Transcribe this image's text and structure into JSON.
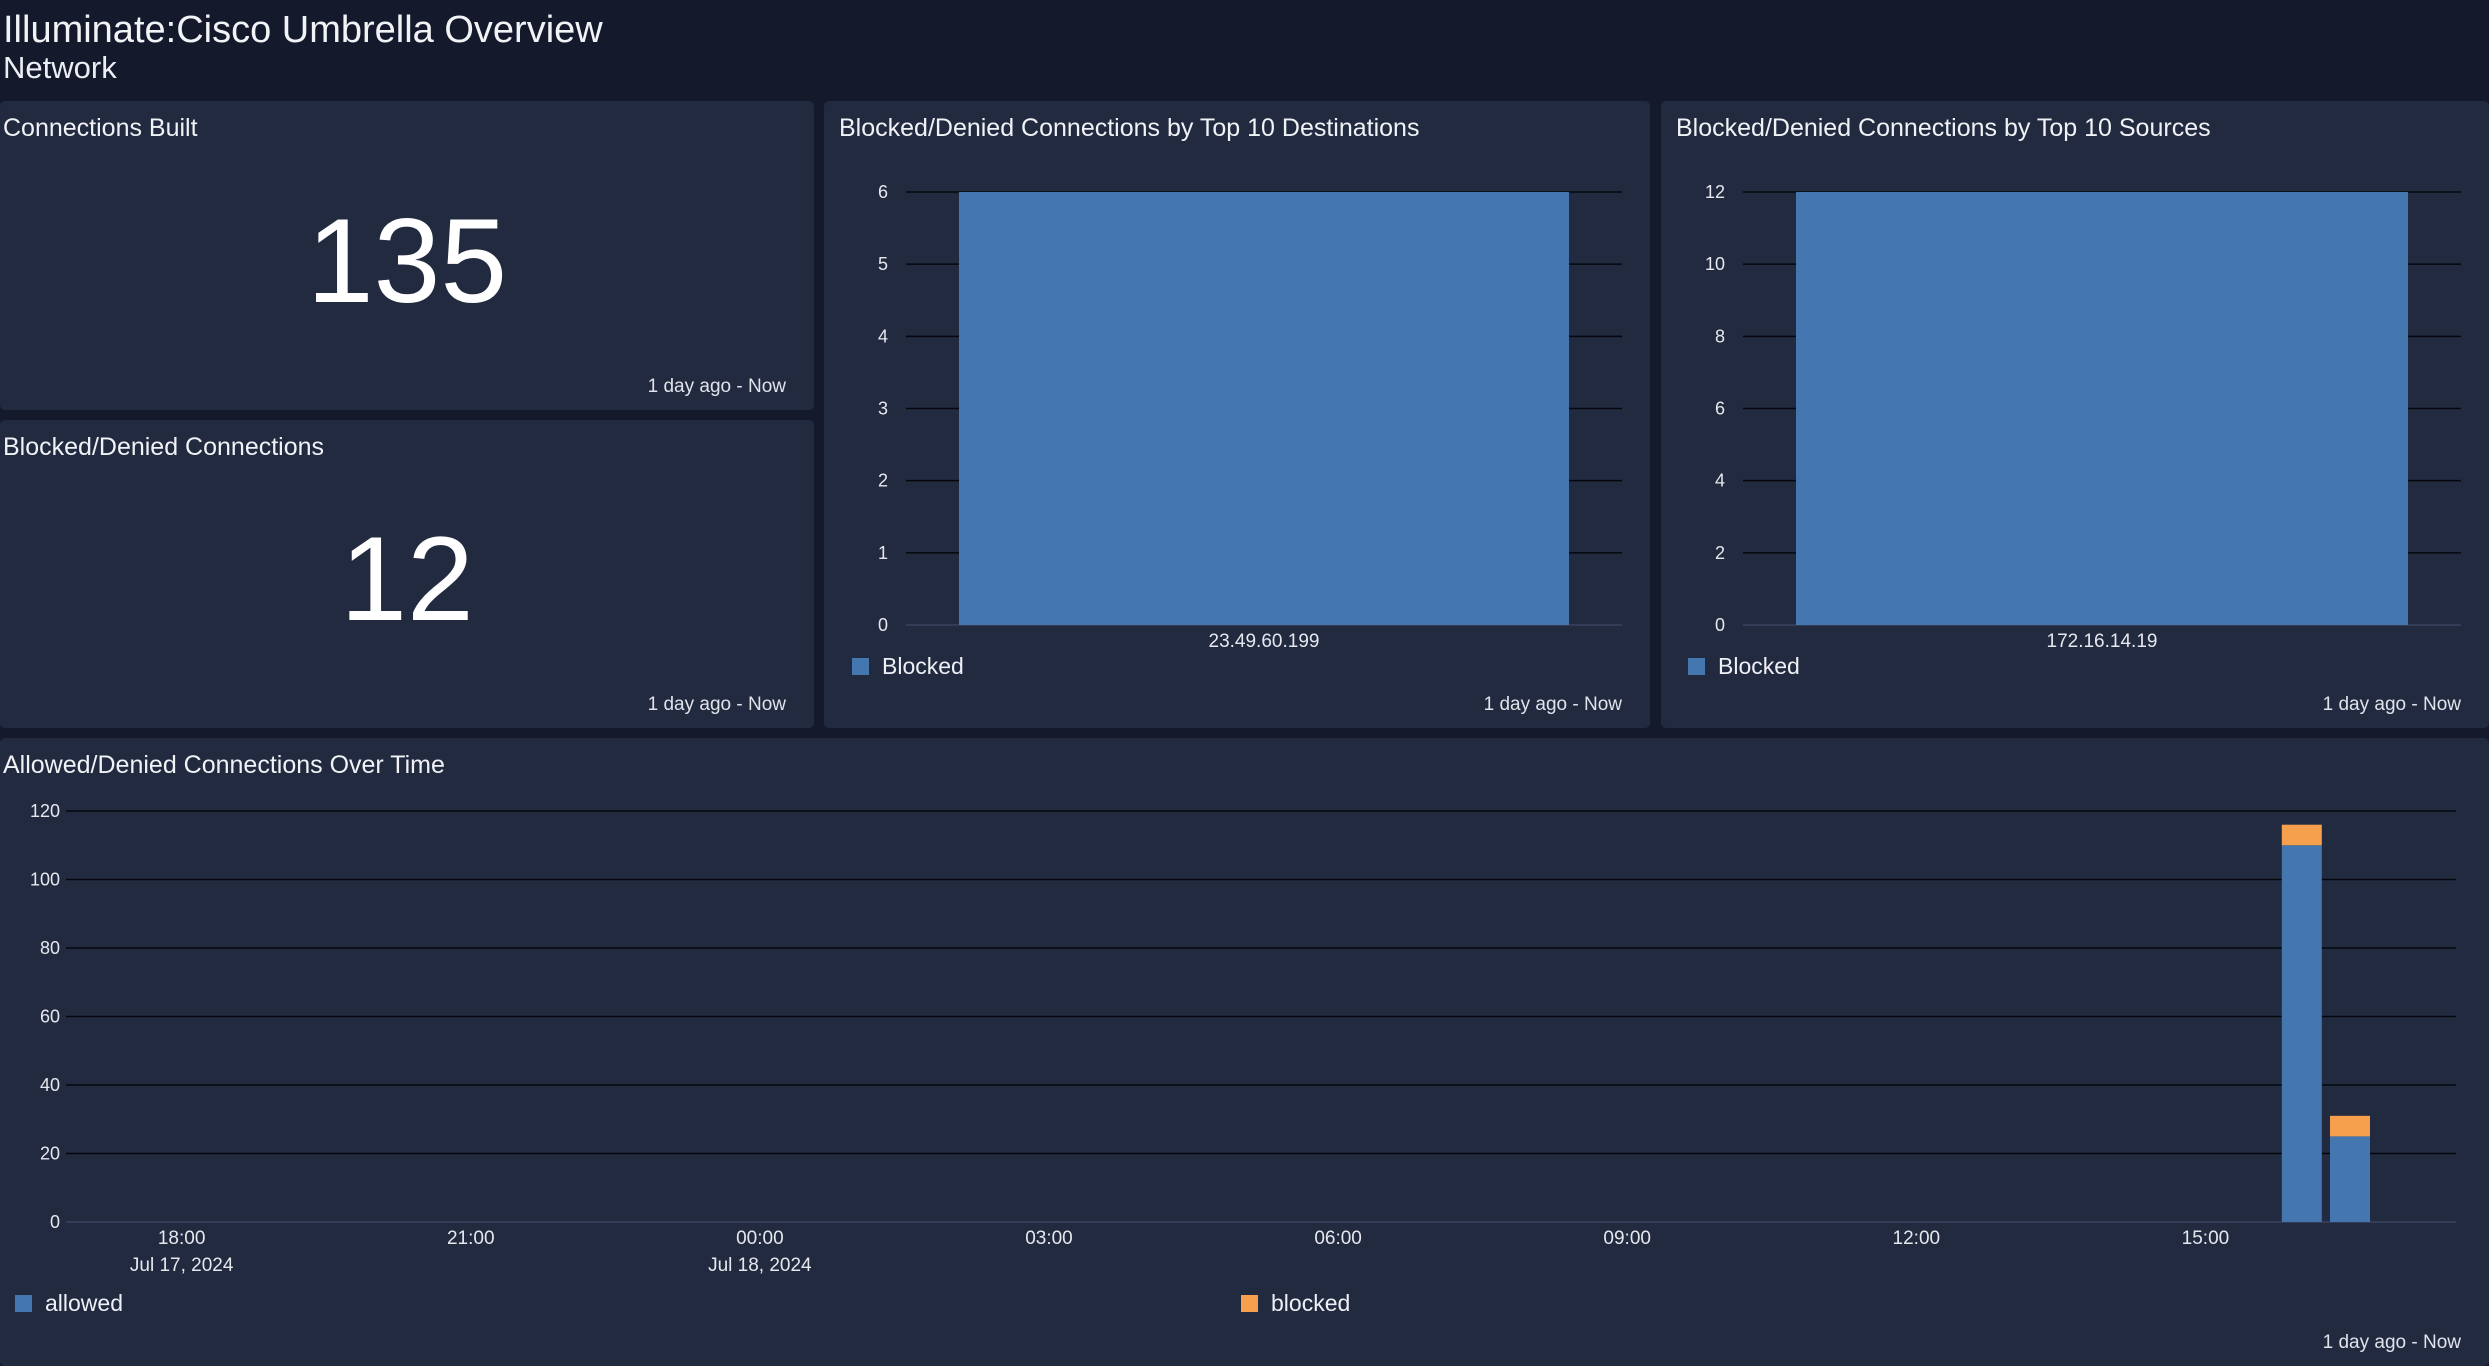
{
  "dashboard": {
    "title": "Illuminate:Cisco Umbrella Overview",
    "subtitle": "Network"
  },
  "colors": {
    "background": "#141a2b",
    "panel": "#222a40",
    "allowed": "#4477b0",
    "blocked": "#f6a04d"
  },
  "panels": {
    "connections_built": {
      "title": "Connections Built",
      "value": "135",
      "range": "1 day ago - Now"
    },
    "blocked_denied": {
      "title": "Blocked/Denied Connections",
      "value": "12",
      "range": "1 day ago - Now"
    },
    "top_destinations": {
      "title": "Blocked/Denied Connections by Top 10 Destinations",
      "legend": "Blocked",
      "range": "1 day ago - Now"
    },
    "top_sources": {
      "title": "Blocked/Denied Connections by Top 10 Sources",
      "legend": "Blocked",
      "range": "1 day ago - Now"
    },
    "over_time": {
      "title": "Allowed/Denied Connections Over Time",
      "legend_allowed": "allowed",
      "legend_blocked": "blocked",
      "range": "1 day ago - Now"
    }
  },
  "chart_data": [
    {
      "type": "bar",
      "title": "Blocked/Denied Connections by Top 10 Destinations",
      "categories": [
        "23.49.60.199"
      ],
      "series": [
        {
          "name": "Blocked",
          "values": [
            6
          ]
        }
      ],
      "ylim": [
        0,
        6
      ],
      "yticks": [
        0,
        1,
        2,
        3,
        4,
        5,
        6
      ],
      "grid": true,
      "legend": "bottom-left"
    },
    {
      "type": "bar",
      "title": "Blocked/Denied Connections by Top 10 Sources",
      "categories": [
        "172.16.14.19"
      ],
      "series": [
        {
          "name": "Blocked",
          "values": [
            12
          ]
        }
      ],
      "ylim": [
        0,
        12
      ],
      "yticks": [
        0,
        2,
        4,
        6,
        8,
        10,
        12
      ],
      "grid": true,
      "legend": "bottom-left"
    },
    {
      "type": "bar",
      "stacked": true,
      "title": "Allowed/Denied Connections Over Time",
      "x_ticks": [
        {
          "label": "18:00",
          "date": "Jul 17, 2024",
          "hour": 18
        },
        {
          "label": "21:00",
          "date": "",
          "hour": 21
        },
        {
          "label": "00:00",
          "date": "Jul 18, 2024",
          "hour": 24
        },
        {
          "label": "03:00",
          "date": "",
          "hour": 27
        },
        {
          "label": "06:00",
          "date": "",
          "hour": 30
        },
        {
          "label": "09:00",
          "date": "",
          "hour": 33
        },
        {
          "label": "12:00",
          "date": "",
          "hour": 36
        },
        {
          "label": "15:00",
          "date": "",
          "hour": 39
        }
      ],
      "x_range_hours": [
        16.8,
        41.6
      ],
      "x": [
        "Jul 18, 2024 16:00",
        "Jul 18, 2024 16:30"
      ],
      "bar_hours": [
        40.0,
        40.5
      ],
      "series": [
        {
          "name": "allowed",
          "values": [
            110,
            25
          ]
        },
        {
          "name": "blocked",
          "values": [
            6,
            6
          ]
        }
      ],
      "ylim": [
        0,
        120
      ],
      "yticks": [
        0,
        20,
        40,
        60,
        80,
        100,
        120
      ],
      "grid": true,
      "legend": "bottom"
    }
  ]
}
